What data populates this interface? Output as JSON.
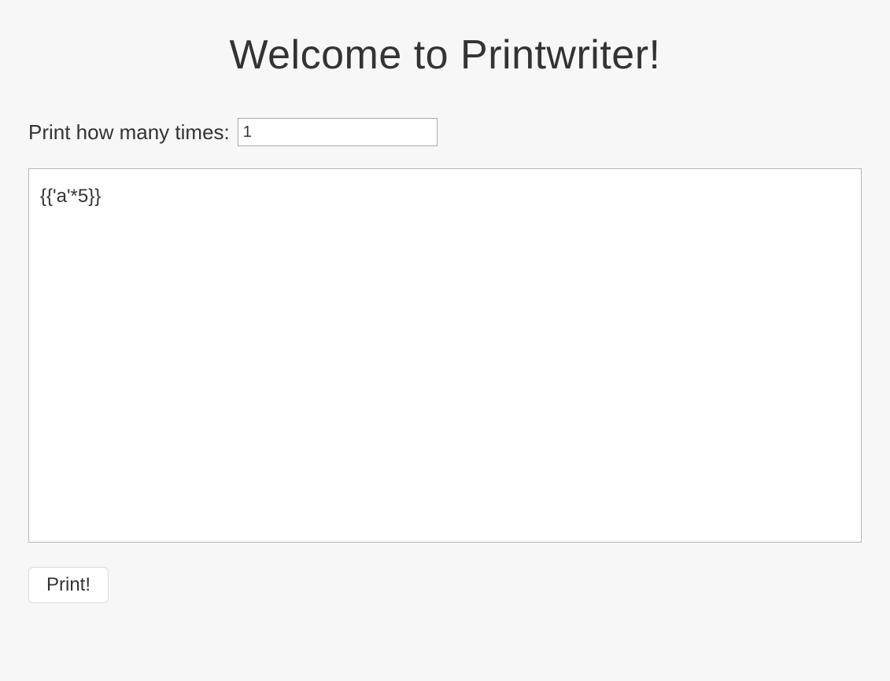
{
  "header": {
    "title": "Welcome to Printwriter!"
  },
  "form": {
    "times_label": "Print how many times: ",
    "times_value": "1",
    "content_value": "{{'a'*5}}",
    "submit_label": "Print!"
  }
}
